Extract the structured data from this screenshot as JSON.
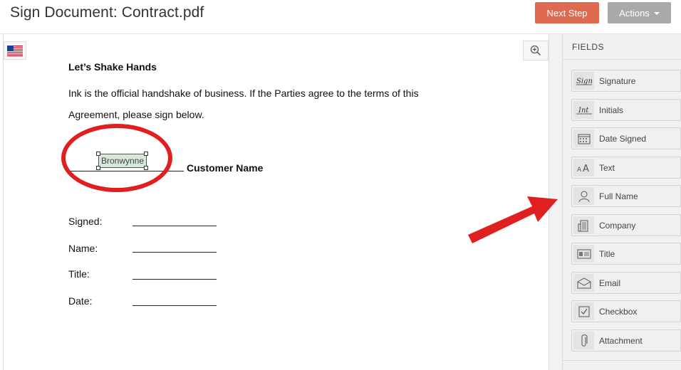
{
  "header": {
    "title": "Sign Document: Contract.pdf",
    "next_step_label": "Next Step",
    "actions_label": "Actions"
  },
  "document": {
    "heading": "Let’s Shake Hands",
    "para_line1": "Ink is the official handshake of business.  If the Parties agree to the terms of this",
    "para_line2": "Agreement, please sign below.",
    "signature_value": "Bronwynne",
    "customer_label": "Customer Name",
    "form_labels": {
      "signed": "Signed:",
      "name": "Name:",
      "title": "Title:",
      "date": "Date:"
    }
  },
  "sidebar": {
    "title": "FIELDS",
    "items": [
      {
        "label": "Signature",
        "icon": "signature-icon"
      },
      {
        "label": "Initials",
        "icon": "initials-icon"
      },
      {
        "label": "Date Signed",
        "icon": "calendar-icon"
      },
      {
        "label": "Text",
        "icon": "text-icon"
      },
      {
        "label": "Full Name",
        "icon": "person-icon"
      },
      {
        "label": "Company",
        "icon": "building-icon"
      },
      {
        "label": "Title",
        "icon": "id-card-icon"
      },
      {
        "label": "Email",
        "icon": "envelope-icon"
      },
      {
        "label": "Checkbox",
        "icon": "checkbox-icon"
      },
      {
        "label": "Attachment",
        "icon": "paperclip-icon"
      }
    ]
  },
  "colors": {
    "next_step": "#e06a4f",
    "actions": "#a9a9a9",
    "annotation_red": "#e02020",
    "signature_fill": "#d7ead9"
  }
}
